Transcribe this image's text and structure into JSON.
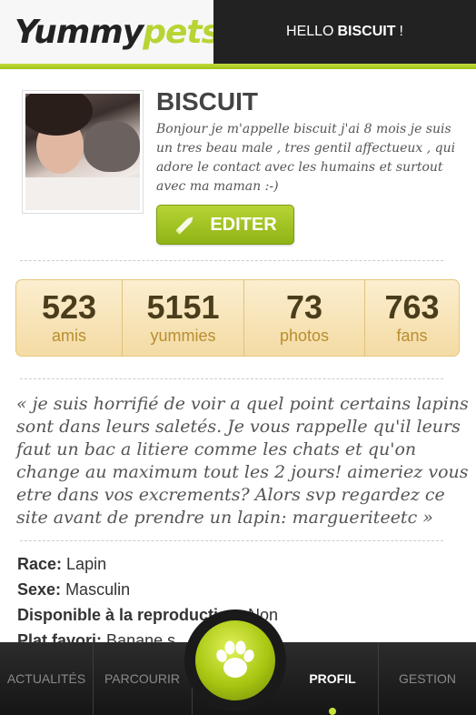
{
  "header": {
    "logo_part1": "Yummy",
    "logo_part2": "pets",
    "greeting_prefix": "HELLO",
    "greeting_name": "BISCUIT",
    "greeting_suffix": "!"
  },
  "profile": {
    "name": "BISCUIT",
    "bio": "Bonjour je m'appelle biscuit j'ai 8 mois je suis un tres beau male , tres gentil affectueux , qui adore le contact avec les humains et surtout avec ma maman :-)",
    "edit_label": "EDITER"
  },
  "stats": [
    {
      "value": "523",
      "label": "amis"
    },
    {
      "value": "5151",
      "label": "yummies"
    },
    {
      "value": "73",
      "label": "photos"
    },
    {
      "value": "763",
      "label": "fans"
    }
  ],
  "quote": "« je suis horrifié de voir a quel point certains lapins sont dans leurs saletés. Je vous rappelle qu'il leurs faut un bac a litiere comme les chats et qu'on change au maximum tout les 2 jours! aimeriez vous etre dans vos excrements? Alors svp regardez ce site avant de prendre un lapin: margueriteetc »",
  "info": {
    "race_label": "Race:",
    "race_value": "Lapin",
    "sexe_label": "Sexe:",
    "sexe_value": "Masculin",
    "repro_label": "Disponible à la reproduction:",
    "repro_value": "Non",
    "plat_label": "Plat favori:",
    "plat_value": "Banane s"
  },
  "nav": {
    "actualites": "ACTUALITÉS",
    "parcourir": "PARCOURIR",
    "profil": "PROFIL",
    "gestion": "GESTION"
  },
  "colors": {
    "accent": "#a7c510",
    "header_dark": "#222222",
    "stats_bg": "#f4dba4"
  }
}
